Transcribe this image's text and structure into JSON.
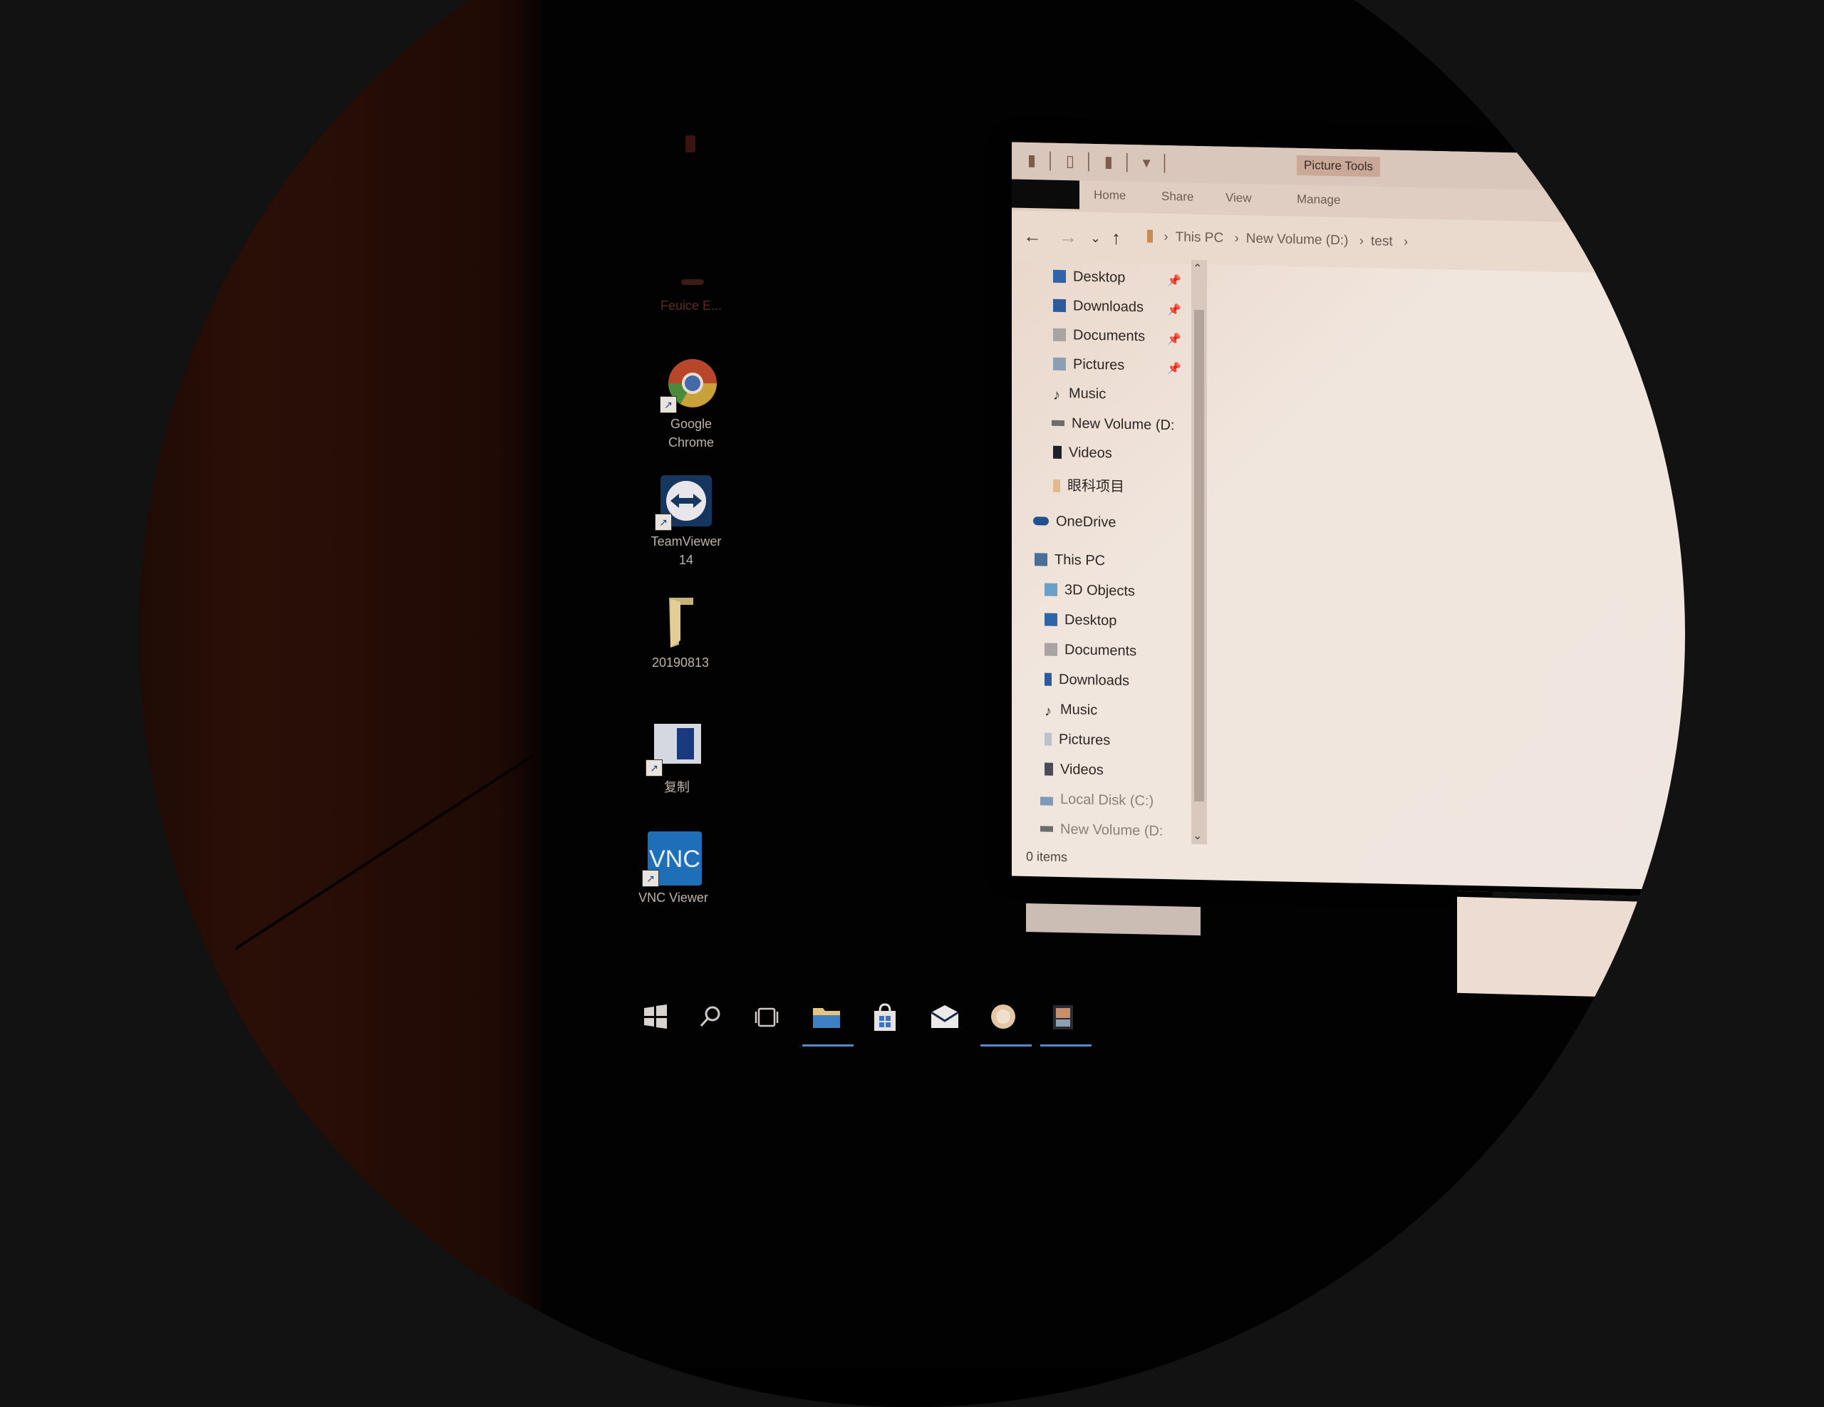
{
  "desktop": {
    "icons": [
      {
        "label": "",
        "icon": "faded-app-icon"
      },
      {
        "label": "Feuice E...",
        "icon": "faded-app-icon"
      },
      {
        "label": "Google\nChrome",
        "icon": "chrome-icon"
      },
      {
        "label": "TeamViewer\n14",
        "icon": "teamviewer-icon"
      },
      {
        "label": "20190813",
        "icon": "folder-icon"
      },
      {
        "label": "复制",
        "icon": "document-shortcut-icon"
      },
      {
        "label": "VNC Viewer",
        "icon": "vnc-icon"
      }
    ]
  },
  "explorer": {
    "context_title": "Picture Tools",
    "ribbon_tabs": [
      "Home",
      "Share",
      "View",
      "Manage"
    ],
    "breadcrumb": [
      "This PC",
      "New Volume (D:)",
      "test"
    ],
    "quick_access": [
      {
        "label": "Desktop",
        "pinned": true
      },
      {
        "label": "Downloads",
        "pinned": true
      },
      {
        "label": "Documents",
        "pinned": true
      },
      {
        "label": "Pictures",
        "pinned": true
      },
      {
        "label": "Music",
        "pinned": false
      },
      {
        "label": "New Volume (D:",
        "pinned": false
      },
      {
        "label": "Videos",
        "pinned": false
      },
      {
        "label": "眼科项目",
        "pinned": false
      }
    ],
    "onedrive": "OneDrive",
    "this_pc": "This PC",
    "this_pc_items": [
      "3D Objects",
      "Desktop",
      "Documents",
      "Downloads",
      "Music",
      "Pictures",
      "Videos",
      "Local Disk (C:)",
      "New Volume (D:"
    ],
    "status": "0 items"
  },
  "taskbar": {
    "items": [
      "start-icon",
      "search-icon",
      "task-view-icon",
      "file-explorer-icon",
      "store-icon",
      "mail-icon",
      "app-circle-icon",
      "photos-icon"
    ]
  },
  "colors": {
    "accent": "#5a87c9",
    "window_bg": "#efe6df",
    "wall": "#2a0f07"
  }
}
